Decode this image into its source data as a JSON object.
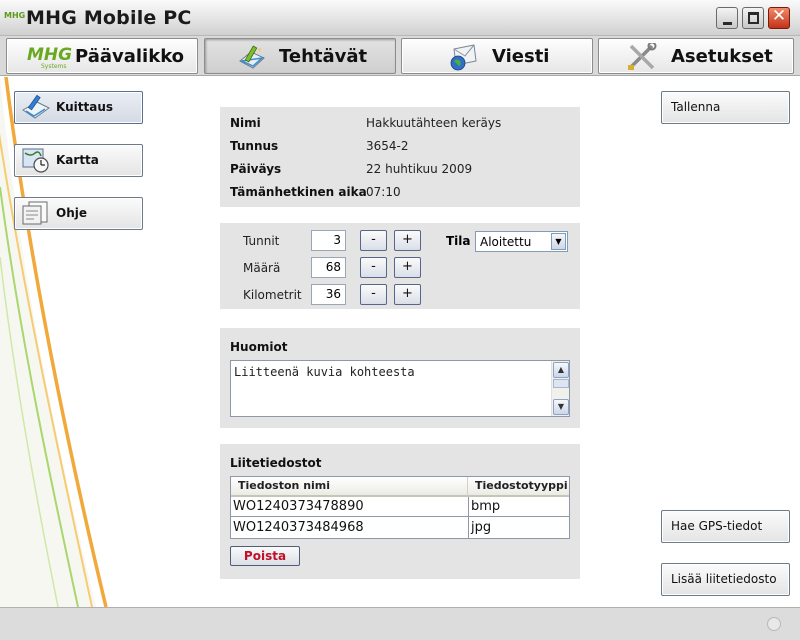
{
  "window": {
    "logo_text": "MHG",
    "title": "MHG Mobile PC"
  },
  "tabs": [
    {
      "label": "Päävalikko",
      "icon": "mhg-logo",
      "active": false
    },
    {
      "label": "Tehtävät",
      "icon": "pencil-notepad-icon",
      "active": true
    },
    {
      "label": "Viesti",
      "icon": "envelope-globe-icon",
      "active": false
    },
    {
      "label": "Asetukset",
      "icon": "tools-icon",
      "active": false
    }
  ],
  "tab_logo": {
    "main": "MHG",
    "sub": "Systems"
  },
  "sidebar": {
    "items": [
      {
        "label": "Kuittaus",
        "icon": "signoff-pen-icon",
        "active": true
      },
      {
        "label": "Kartta",
        "icon": "map-clock-icon",
        "active": false
      },
      {
        "label": "Ohje",
        "icon": "help-document-icon",
        "active": false
      }
    ]
  },
  "actions": {
    "save": "Tallenna",
    "gps": "Hae GPS-tiedot",
    "add_attachment": "Lisää liitetiedosto"
  },
  "info": {
    "rows": [
      {
        "label": "Nimi",
        "value": "Hakkuutähteen keräys"
      },
      {
        "label": "Tunnus",
        "value": "3654-2"
      },
      {
        "label": "Päiväys",
        "value": "22 huhtikuu 2009"
      },
      {
        "label": "Tämänhetkinen aika",
        "value": "07:10"
      }
    ]
  },
  "quantities": {
    "rows": [
      {
        "label": "Tunnit",
        "value": "3"
      },
      {
        "label": "Määrä",
        "value": "68"
      },
      {
        "label": "Kilometrit",
        "value": "36"
      }
    ],
    "minus": "-",
    "plus": "+",
    "status_label": "Tila",
    "status_value": "Aloitettu"
  },
  "notes": {
    "title": "Huomiot",
    "text": "Liitteenä kuvia kohteesta"
  },
  "attachments": {
    "title": "Liitetiedostot",
    "columns": [
      "Tiedoston nimi",
      "Tiedostotyyppi"
    ],
    "rows": [
      {
        "name": "WO1240373478890",
        "type": "bmp"
      },
      {
        "name": "WO1240373484968",
        "type": "jpg"
      }
    ],
    "delete_label": "Poista"
  },
  "colors": {
    "accent_green": "#5e9a1c",
    "swoosh_orange": "#f2a93b",
    "delete_red": "#c0102a",
    "panel_gray": "#e4e4e4"
  }
}
